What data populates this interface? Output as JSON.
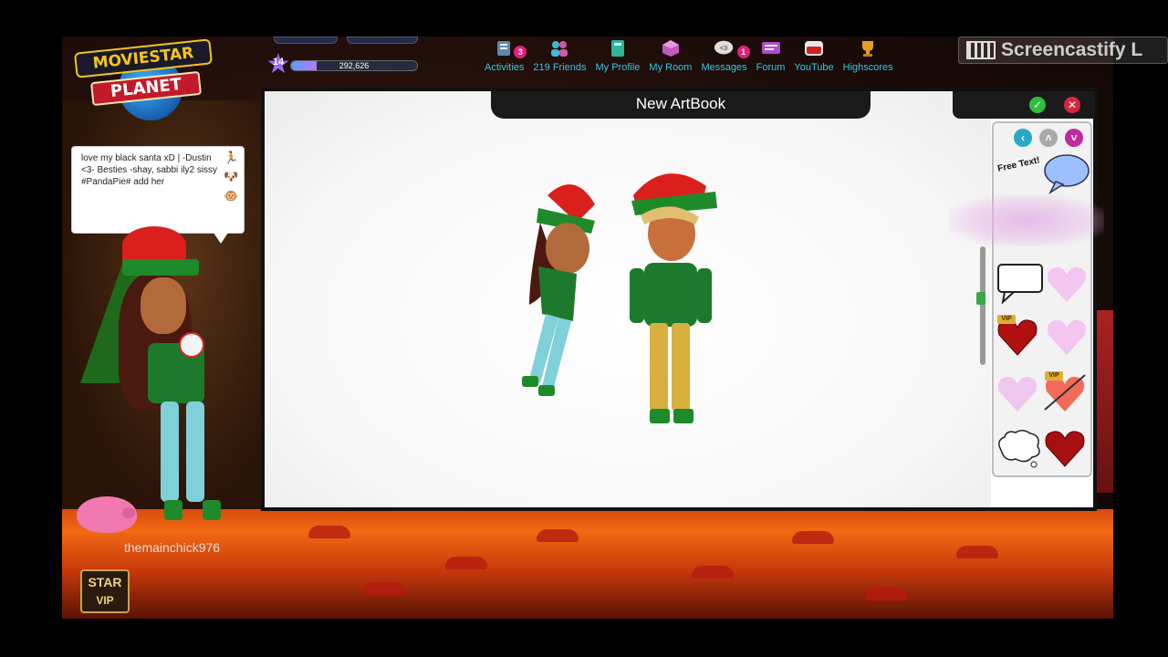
{
  "app": {
    "logo_line1": "MOVIESTAR",
    "logo_line2": "PLANET"
  },
  "profile_stats": {
    "level": "14",
    "fame_value": "292,626",
    "fame_progress": 0.2
  },
  "nav": {
    "items": [
      {
        "label": "Activities",
        "icon": "clipboard-icon",
        "badge": "3"
      },
      {
        "label": "219 Friends",
        "icon": "friends-icon",
        "badge": ""
      },
      {
        "label": "My Profile",
        "icon": "profile-book-icon",
        "badge": ""
      },
      {
        "label": "My Room",
        "icon": "room-cube-icon",
        "badge": ""
      },
      {
        "label": "Messages",
        "icon": "message-bubble-icon",
        "badge": "1",
        "bubble_text": "<3"
      },
      {
        "label": "Forum",
        "icon": "forum-icon",
        "badge": ""
      },
      {
        "label": "YouTube",
        "icon": "youtube-icon",
        "badge": ""
      },
      {
        "label": "Highscores",
        "icon": "trophy-icon",
        "badge": ""
      }
    ]
  },
  "recorder": {
    "label": "Screencastify L"
  },
  "status": {
    "text": "love my black santa xD | -Dustin <3- Besties -shay, sabbi  ily2 sissy #PandaPie# add her"
  },
  "user": {
    "username": "themainchick976",
    "badge_line1": "STAR",
    "badge_line2": "VIP"
  },
  "artbook": {
    "title": "New ArtBook",
    "free_text_label": "Free Text!",
    "vip_label": "VIP"
  },
  "colors": {
    "nav_label": "#33c8e8",
    "accent_pink": "#e0207a",
    "confirm": "#2fbf3c",
    "close": "#d6263a"
  }
}
